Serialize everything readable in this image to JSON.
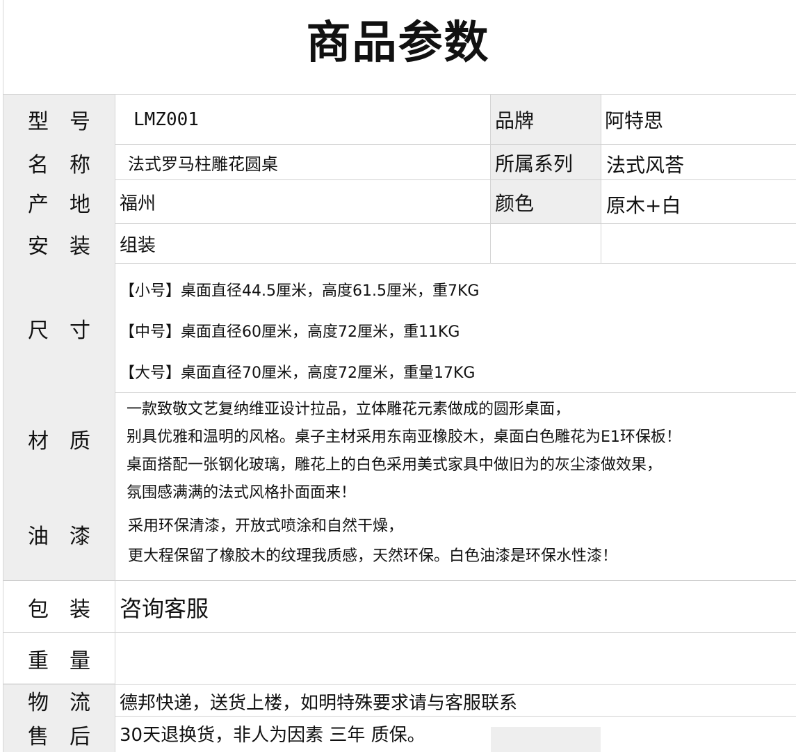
{
  "title": "商品参数",
  "rows": {
    "model": {
      "label": "型号",
      "value": "LMZ001"
    },
    "brand": {
      "label": "品牌",
      "value": "阿特思"
    },
    "name": {
      "label": "名称",
      "value": "法式罗马柱雕花圆桌"
    },
    "series": {
      "label": "所属系列",
      "value": "法式风荅"
    },
    "origin": {
      "label": "产地",
      "value": "福州"
    },
    "color": {
      "label": "颜色",
      "value": "原木+白"
    },
    "install": {
      "label": "安装",
      "value": "组装"
    },
    "size": {
      "label": "尺寸",
      "lines": [
        "【小号】桌面直径44.5厘米，高度61.5厘米，重7KG",
        "【中号】桌面直径60厘米，高度72厘米，重11KG",
        "【大号】桌面直径70厘米，高度72厘米，重量17KG"
      ]
    },
    "material": {
      "label": "材质",
      "lines": [
        "一款致敬文艺复纳维亚设计拉品，立体雕花元素做成的圆形桌面，",
        "别具优雅和温明的风格。桌子主材采用东南亚橡胶木，桌面白色雕花为E1环保板！",
        "桌面搭配一张钢化玻璃，雕花上的白色采用美式家具中做旧为的灰尘漆做效果，",
        "氛围感满满的法式风格扑面面来！"
      ]
    },
    "paint": {
      "label": "油漆",
      "lines": [
        "采用环保清漆，开放式喷涂和自然干燥，",
        "更大程保留了橡胶木的纹理我质感，天然环保。白色油漆是环保水性漆！"
      ]
    },
    "packaging": {
      "label": "包装",
      "value": "咨询客服"
    },
    "weight": {
      "label": "重量",
      "value": ""
    },
    "logistics": {
      "label": "物流",
      "value": "德邦快递，送货上楼，如明特殊要求请与客服联系"
    },
    "aftersale": {
      "label": "售后",
      "value": "30天退换货，非人为因素 三年 质保。"
    }
  }
}
